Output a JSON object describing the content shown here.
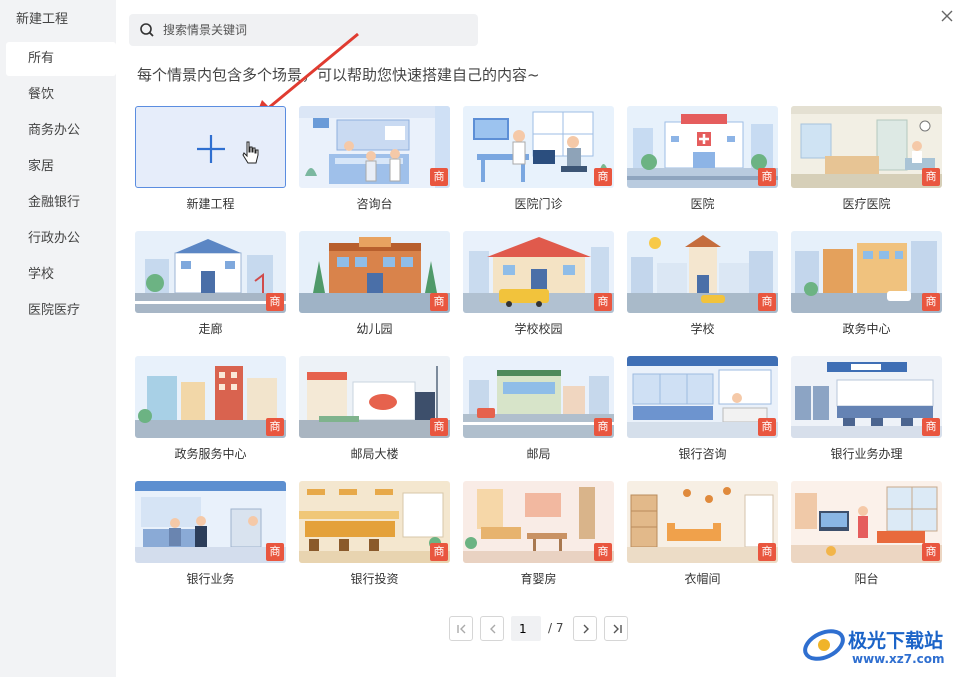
{
  "sidebar": {
    "title": "新建工程",
    "items": [
      {
        "label": "所有"
      },
      {
        "label": "餐饮"
      },
      {
        "label": "商务办公"
      },
      {
        "label": "家居"
      },
      {
        "label": "金融银行"
      },
      {
        "label": "行政办公"
      },
      {
        "label": "学校"
      },
      {
        "label": "医院医疗"
      }
    ]
  },
  "search": {
    "placeholder": "搜索情景关键词"
  },
  "subtitle": "每个情景内包含多个场景，可以帮助您快速搭建自己的内容~",
  "badge_label": "商",
  "cards": [
    {
      "label": "新建工程"
    },
    {
      "label": "咨询台"
    },
    {
      "label": "医院门诊"
    },
    {
      "label": "医院"
    },
    {
      "label": "医疗医院"
    },
    {
      "label": "走廊"
    },
    {
      "label": "幼儿园"
    },
    {
      "label": "学校校园"
    },
    {
      "label": "学校"
    },
    {
      "label": "政务中心"
    },
    {
      "label": "政务服务中心"
    },
    {
      "label": "邮局大楼"
    },
    {
      "label": "邮局"
    },
    {
      "label": "银行咨询"
    },
    {
      "label": "银行业务办理"
    },
    {
      "label": "银行业务"
    },
    {
      "label": "银行投资"
    },
    {
      "label": "育婴房"
    },
    {
      "label": "衣帽间"
    },
    {
      "label": "阳台"
    }
  ],
  "pagination": {
    "current": "1",
    "total": "/ 7"
  },
  "watermark": {
    "name": "极光下载站",
    "url": "www.xz7.com"
  },
  "colors": {
    "accent": "#2f6fd0",
    "badge": "#e9563f",
    "sidebar_bg": "#f2f3f5"
  }
}
